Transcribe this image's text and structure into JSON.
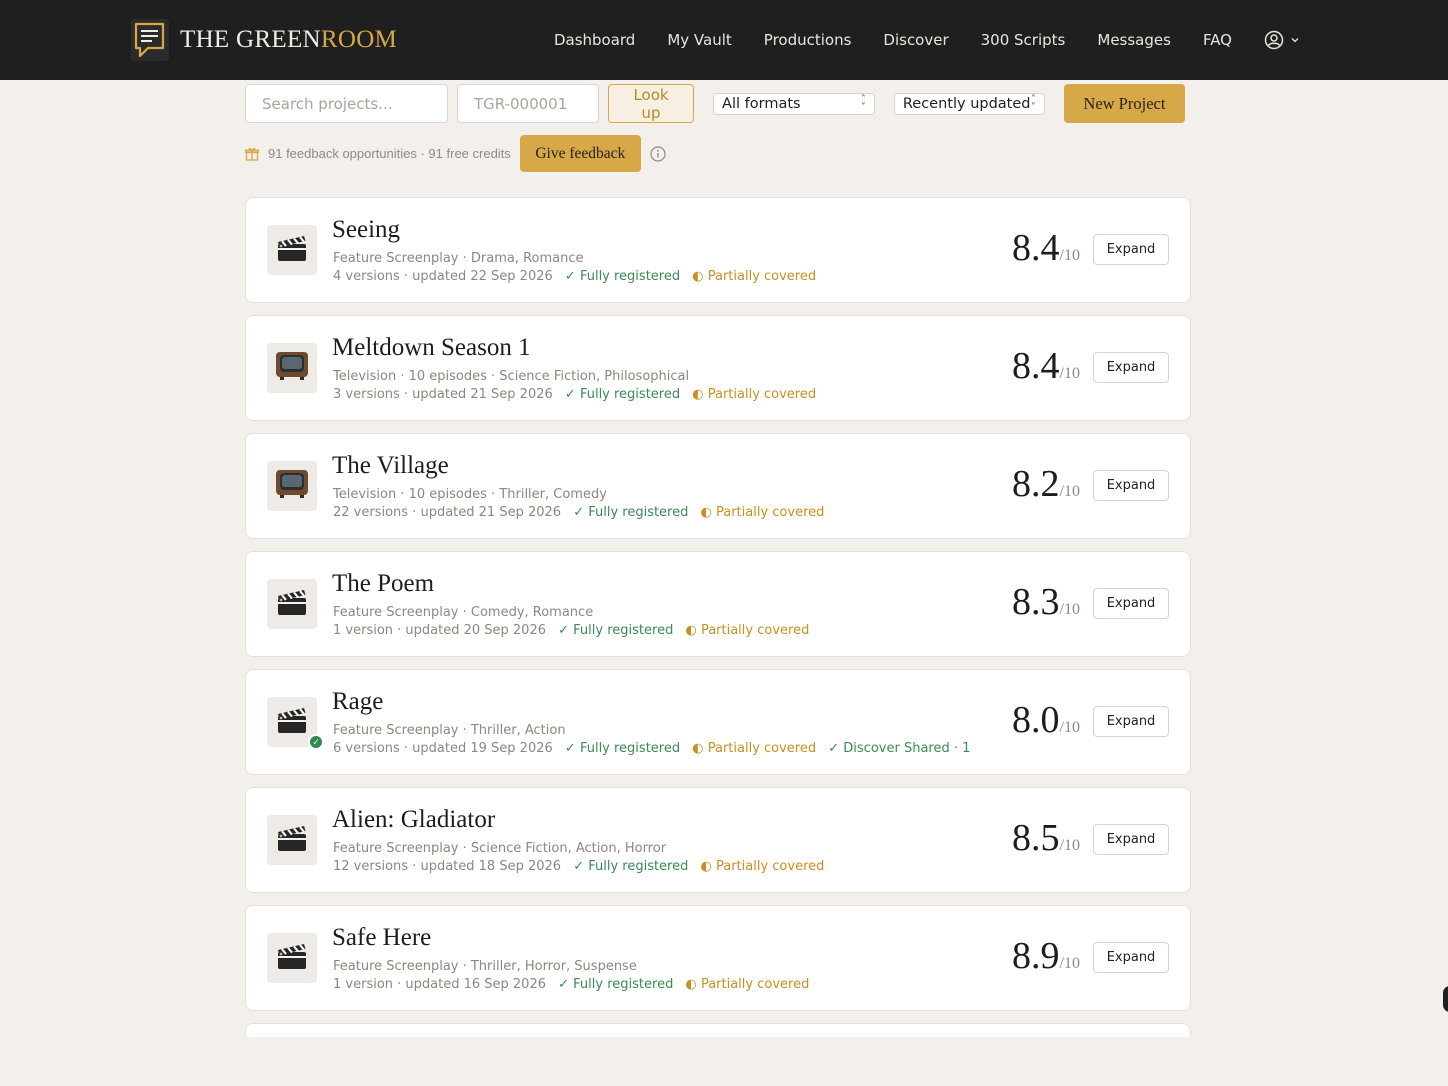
{
  "brand": {
    "name_part1": "THE GREEN",
    "name_part2": "ROOM",
    "accent": "#d6a848"
  },
  "nav": {
    "items": [
      {
        "label": "Dashboard"
      },
      {
        "label": "My Vault"
      },
      {
        "label": "Productions"
      },
      {
        "label": "Discover"
      },
      {
        "label": "300 Scripts"
      },
      {
        "label": "Messages"
      },
      {
        "label": "FAQ"
      }
    ],
    "account_icon": "user-circle-icon"
  },
  "toolbar": {
    "search_placeholder": "Search projects...",
    "tgr_placeholder": "TGR-000001",
    "lookup_label": "Look up",
    "format_selected": "All formats",
    "sort_selected": "Recently updated",
    "new_project_label": "New Project"
  },
  "feedback": {
    "text": "91 feedback opportunities · 91 free credits",
    "button_label": "Give feedback"
  },
  "projects": [
    {
      "title": "Seeing",
      "meta": "Feature Screenplay · Drama, Romance",
      "details": "4 versions · updated 22 Sep 2026",
      "registered": "✓ Fully registered",
      "coverage": "◐ Partially covered",
      "extra": "",
      "score": "8.4",
      "score_den": "/10",
      "expand": "Expand",
      "icon": "clapperboard-icon"
    },
    {
      "title": "Meltdown Season 1",
      "meta": "Television · 10 episodes · Science Fiction, Philosophical",
      "details": "3 versions · updated 21 Sep 2026",
      "registered": "✓ Fully registered",
      "coverage": "◐ Partially covered",
      "extra": "",
      "score": "8.4",
      "score_den": "/10",
      "expand": "Expand",
      "icon": "television-icon"
    },
    {
      "title": "The Village",
      "meta": "Television · 10 episodes · Thriller, Comedy",
      "details": "22 versions · updated 21 Sep 2026",
      "registered": "✓ Fully registered",
      "coverage": "◐ Partially covered",
      "extra": "",
      "score": "8.2",
      "score_den": "/10",
      "expand": "Expand",
      "icon": "television-icon"
    },
    {
      "title": "The Poem",
      "meta": "Feature Screenplay · Comedy, Romance",
      "details": "1 version · updated 20 Sep 2026",
      "registered": "✓ Fully registered",
      "coverage": "◐ Partially covered",
      "extra": "",
      "score": "8.3",
      "score_den": "/10",
      "expand": "Expand",
      "icon": "clapperboard-icon"
    },
    {
      "title": "Rage",
      "meta": "Feature Screenplay · Thriller, Action",
      "details": "6 versions · updated 19 Sep 2026",
      "registered": "✓ Fully registered",
      "coverage": "◐ Partially covered",
      "extra": "✓ Discover   Shared · 1",
      "score": "8.0",
      "score_den": "/10",
      "expand": "Expand",
      "icon": "clapperboard-icon"
    },
    {
      "title": "Alien: Gladiator",
      "meta": "Feature Screenplay · Science Fiction, Action, Horror",
      "details": "12 versions · updated 18 Sep 2026",
      "registered": "✓ Fully registered",
      "coverage": "◐ Partially covered",
      "extra": "",
      "score": "8.5",
      "score_den": "/10",
      "expand": "Expand",
      "icon": "clapperboard-icon"
    },
    {
      "title": "Safe Here",
      "meta": "Feature Screenplay · Thriller, Horror, Suspense",
      "details": "1 version · updated 16 Sep 2026",
      "registered": "✓ Fully registered",
      "coverage": "◐ Partially covered",
      "extra": "",
      "score": "8.9",
      "score_den": "/10",
      "expand": "Expand",
      "icon": "clapperboard-icon"
    }
  ]
}
